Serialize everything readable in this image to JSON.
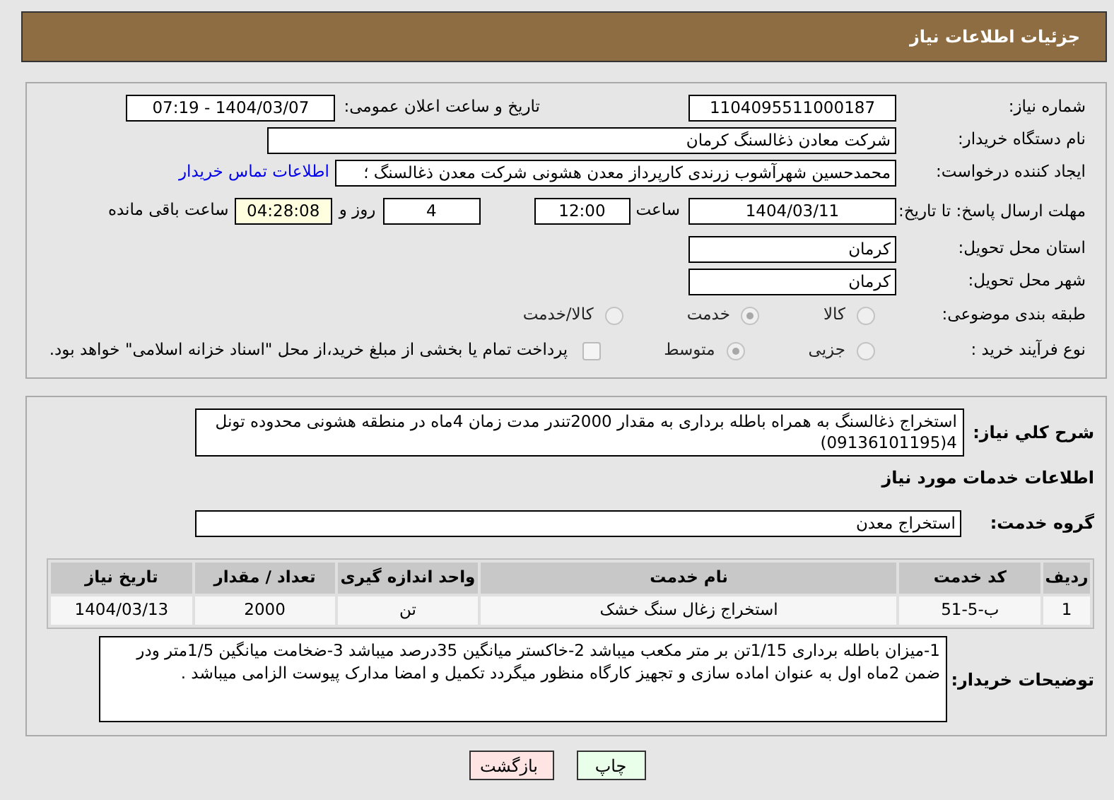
{
  "header": {
    "title": "جزئیات اطلاعات نیاز"
  },
  "need_number": {
    "label": "شماره نیاز:",
    "value": "1104095511000187"
  },
  "announce": {
    "label": "تاریخ و ساعت اعلان عمومی:",
    "value": "1404/03/07 - 07:19"
  },
  "buyer": {
    "label": "نام دستگاه خریدار:",
    "value": "شرکت معادن ذغالسنگ کرمان"
  },
  "requester": {
    "label": "ایجاد کننده درخواست:",
    "value": "محمدحسین شهرآشوب زرندی کارپرداز معدن هشونی شرکت معدن ذغالسنگ ؛",
    "link": "اطلاعات تماس خریدار"
  },
  "deadline": {
    "label": "مهلت ارسال پاسخ: تا تاریخ:",
    "date": "1404/03/11",
    "time_label": "ساعت",
    "time": "12:00",
    "days": "4",
    "days_label": "روز و",
    "remaining": "04:28:08",
    "remaining_label": "ساعت باقی مانده"
  },
  "province": {
    "label": "استان محل تحویل:",
    "value": "کرمان"
  },
  "city": {
    "label": "شهر محل تحویل:",
    "value": "کرمان"
  },
  "category": {
    "label": "طبقه بندی موضوعی:",
    "disabled": true,
    "options": [
      {
        "label": "کالا",
        "selected": false
      },
      {
        "label": "خدمت",
        "selected": true
      },
      {
        "label": "کالا/خدمت",
        "selected": false
      }
    ]
  },
  "process": {
    "label": "نوع فرآیند خرید :",
    "disabled": true,
    "options": [
      {
        "label": "جزیی",
        "selected": false
      },
      {
        "label": "متوسط",
        "selected": true
      }
    ],
    "payment": {
      "label": "پرداخت تمام یا بخشی از مبلغ خرید،از محل \"اسناد خزانه اسلامی\" خواهد بود.",
      "checked": false
    }
  },
  "description": {
    "label": "شرح کلي نیاز:",
    "value": "استخراج ذغالسنگ به همراه باطله برداری به مقدار 2000تندر مدت زمان 4ماه در منطقه هشونی محدوده تونل 4(09136101195)"
  },
  "services_title": "اطلاعات خدمات مورد نیاز",
  "service_group": {
    "label": "گروه خدمت:",
    "value": "استخراج معدن"
  },
  "table": {
    "columns": [
      "ردیف",
      "کد خدمت",
      "نام خدمت",
      "واحد اندازه گیری",
      "تعداد / مقدار",
      "تاریخ نیاز"
    ],
    "rows": [
      [
        "1",
        "ب-5-51",
        "استخراج زغال سنگ خشک",
        "تن",
        "2000",
        "1404/03/13"
      ]
    ]
  },
  "notes": {
    "label": "توضیحات خریدار:",
    "value": "1-میزان باطله برداری 1/15تن بر متر مکعب میباشد 2-خاکستر میانگین 35درصد میباشد 3-ضخامت میانگین 1/5متر ودر ضمن 2ماه اول به عنوان اماده سازی و تجهیز کارگاه منظور میگردد تکمیل و امضا مدارک پیوست الزامی میباشد ."
  },
  "buttons": [
    {
      "kind": "print",
      "label": "چاپ"
    },
    {
      "kind": "back",
      "label": "بازگشت"
    }
  ]
}
